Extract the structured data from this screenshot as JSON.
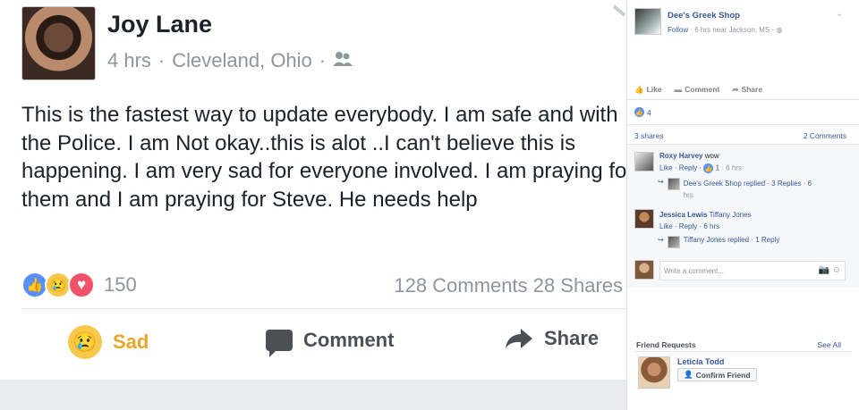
{
  "post": {
    "author": "Joy Lane",
    "time": "4 hrs",
    "separator": "·",
    "location": "Cleveland, Ohio",
    "audience_icon": "friends-icon",
    "text": "This is the fastest way to update everybody. I am safe and with the Police. I am Not okay..this is alot ..I can't believe this is happening. I am very sad for everyone involved. I am praying for them and I am praying for Steve. He needs help",
    "reaction_count": "150",
    "counts": "128 Comments  28 Shares",
    "actions": {
      "sad": "Sad",
      "comment": "Comment",
      "share": "Share"
    }
  },
  "panel": {
    "page_name": "Dee's Greek Shop",
    "follow": "Follow",
    "meta": "· 6 hrs near Jackson, MS ·",
    "actions": {
      "like": "Like",
      "comment": "Comment",
      "share": "Share"
    },
    "like_count": "4",
    "shares": "3 shares",
    "comments_count": "2 Comments",
    "comments": [
      {
        "name": "Roxy Harvey",
        "text": "wow",
        "sub": "Like · Reply ·",
        "sub_likes": "1",
        "sub_time": "· 6 hrs",
        "reply_line1": "Dee's Greek Shop replied · 3 Replies · 6",
        "reply_line2": "hrs"
      },
      {
        "name": "Jessica Lewis",
        "text": "Tiffany Jones",
        "sub": "Like · Reply · 6 hrs",
        "reply_line1": "Tiffany Jones replied · 1 Reply"
      }
    ],
    "write_placeholder": "Write a comment...",
    "friend_requests": {
      "title": "Friend Requests",
      "see_all": "See All",
      "name": "Leticia Todd",
      "confirm": "Confirm Friend"
    }
  }
}
